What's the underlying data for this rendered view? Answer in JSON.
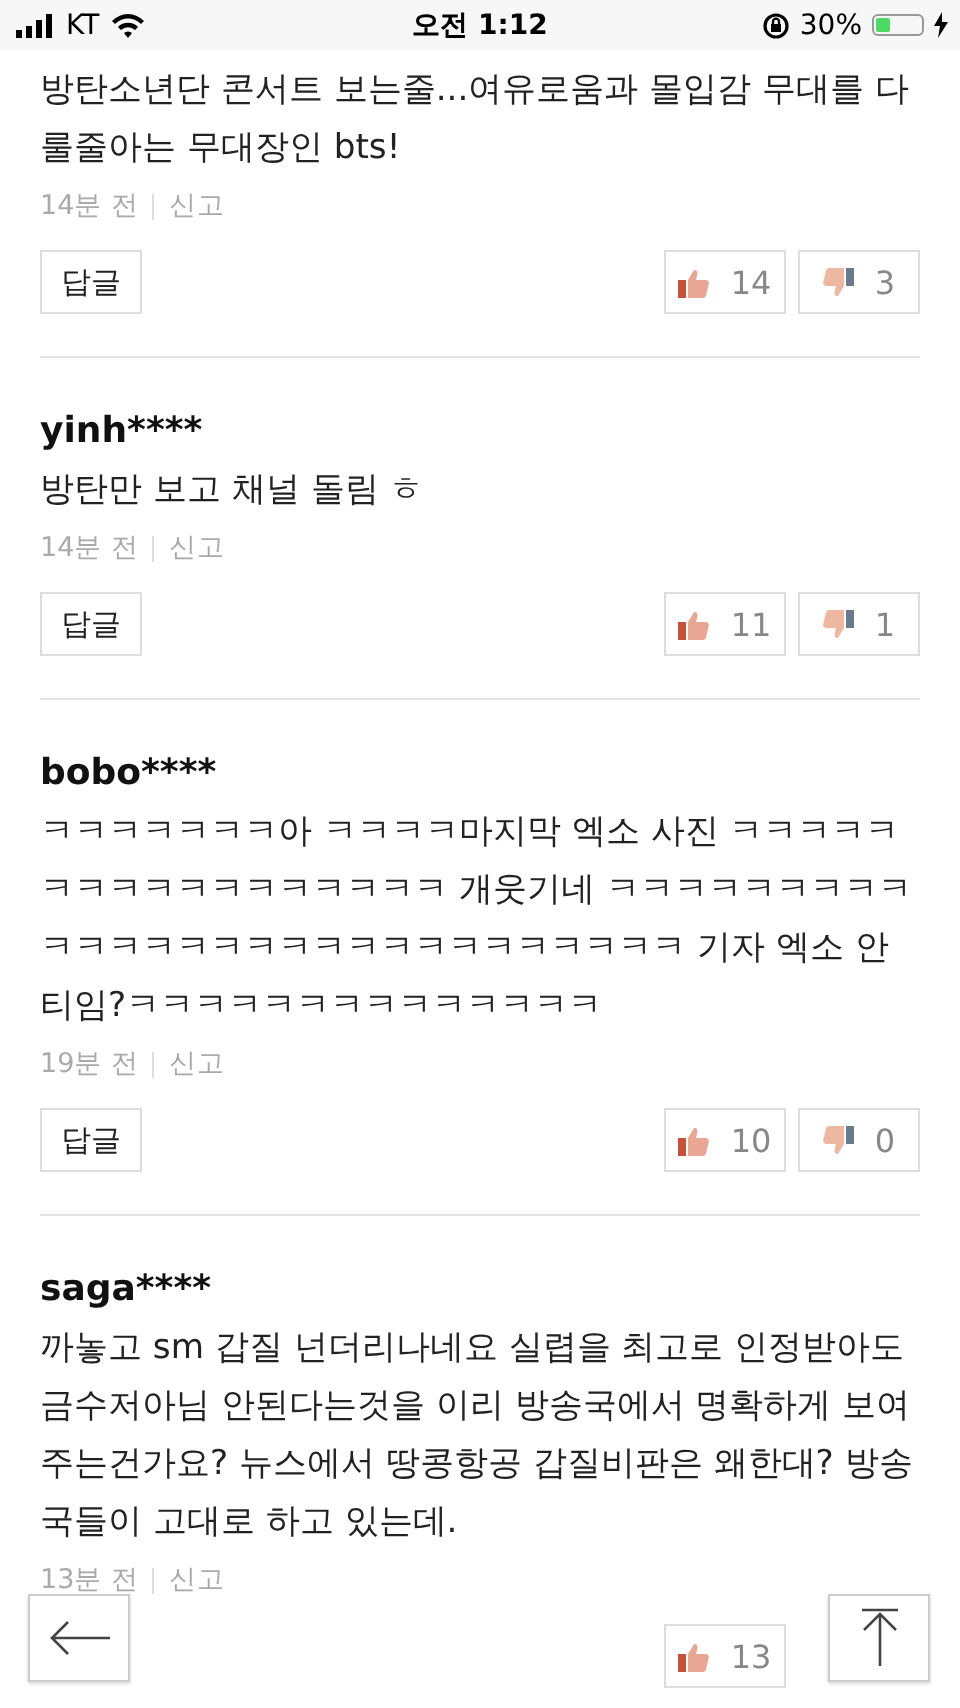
{
  "status_bar": {
    "carrier": "KT",
    "time": "오전 1:12",
    "battery_text": "30%",
    "battery": {
      "level": 0.3
    }
  },
  "comments": [
    {
      "text": "방탄소년단 콘서트 보는줄...여유로움과 몰입감 무대를 다룰줄아는 무대장인 bts!",
      "time": "14분 전",
      "report": "신고",
      "reply": "답글",
      "likes": "14",
      "dislikes": "3"
    },
    {
      "user": "yinh****",
      "text": "방탄만 보고 채널 돌림 ㅎ",
      "time": "14분 전",
      "report": "신고",
      "reply": "답글",
      "likes": "11",
      "dislikes": "1"
    },
    {
      "user": "bobo****",
      "text": "ㅋㅋㅋㅋㅋㅋㅋ아 ㅋㅋㅋㅋ마지막 엑소 사진 ㅋㅋㅋㅋㅋㅋㅋㅋㅋㅋㅋㅋㅋㅋㅋㅋㅋ 개웃기네 ㅋㅋㅋㅋㅋㅋㅋㅋㅋㅋㅋㅋㅋㅋㅋㅋㅋㅋㅋㅋㅋㅋㅋㅋㅋㅋㅋㅋ 기자 엑소 안티임?ㅋㅋㅋㅋㅋㅋㅋㅋㅋㅋㅋㅋㅋㅋ",
      "time": "19분 전",
      "report": "신고",
      "reply": "답글",
      "likes": "10",
      "dislikes": "0"
    },
    {
      "user": "saga****",
      "text": "까놓고 sm 갑질 넌더리나네요 실렵을 최고로 인정받아도 금수저아님 안된다는것을 이리 방송국에서 명확하게 보여주는건가요? 뉴스에서 땅콩항공 갑질비판은 왜한대? 방송국들이 고대로 하고 있는데.",
      "time": "13분 전",
      "report": "신고",
      "likes": "13"
    }
  ]
}
